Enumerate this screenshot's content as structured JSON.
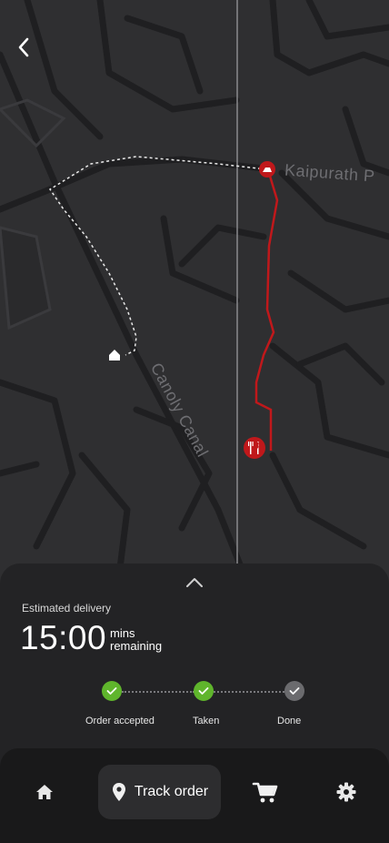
{
  "map": {
    "street_labels": {
      "kaipurath": "Kaipurath P",
      "canoly": "Canoly Canal"
    }
  },
  "tracking": {
    "estimated_label": "Estimated delivery",
    "eta_value": "15:00",
    "eta_unit_line1": "mins",
    "eta_unit_line2": "remaining",
    "steps": [
      {
        "label": "Order accepted",
        "status": "done"
      },
      {
        "label": "Taken",
        "status": "done"
      },
      {
        "label": "Done",
        "status": "pending"
      }
    ]
  },
  "nav": {
    "items": [
      {
        "icon": "home-icon"
      },
      {
        "icon": "location-pin-icon",
        "label": "Track order",
        "active": true
      },
      {
        "icon": "cart-icon"
      },
      {
        "icon": "gear-icon"
      }
    ]
  },
  "colors": {
    "route": "#c0181b",
    "done_step": "#5fb52c",
    "pending_step": "#6b6b6e"
  }
}
